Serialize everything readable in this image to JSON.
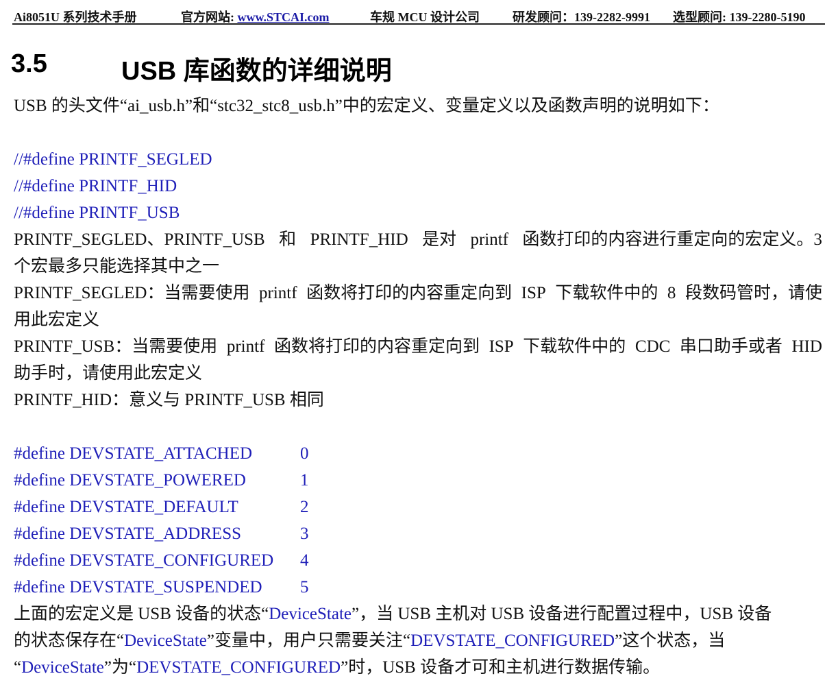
{
  "header": {
    "manual": "Ai8051U 系列技术手册",
    "site_label": "官方网站: ",
    "site_link": "www.STCAI.com",
    "company": "车规 MCU 设计公司",
    "rd_consultant": "研发顾问：139-2282-9991",
    "selection_consultant": "选型顾问: 139-2280-5190"
  },
  "section": {
    "number": "3.5",
    "title": "USB 库函数的详细说明"
  },
  "intro": "USB 的头文件“ai_usb.h”和“stc32_stc8_usb.h”中的宏定义、变量定义以及函数声明的说明如下：",
  "printf_defines": [
    "//#define PRINTF_SEGLED",
    "//#define PRINTF_HID",
    "//#define PRINTF_USB"
  ],
  "printf_desc": [
    [
      "PRINTF_SEGLED、PRINTF_USB",
      "和",
      "PRINTF_HID",
      "是对",
      "printf",
      "函数打印的内容进行重定向的宏定义。3"
    ],
    "个宏最多只能选择其中之一",
    [
      "PRINTF_SEGLED：当需要使用",
      "printf",
      "函数将打印的内容重定向到",
      "ISP",
      "下载软件中的",
      "8",
      "段数码管时，请使"
    ],
    "用此宏定义",
    [
      "PRINTF_USB：当需要使用",
      "printf",
      "函数将打印的内容重定向到",
      "ISP",
      "下载软件中的",
      "CDC",
      "串口助手或者",
      "HID"
    ],
    "助手时，请使用此宏定义",
    "PRINTF_HID：意义与 PRINTF_USB 相同"
  ],
  "devstate_defines": [
    {
      "name": "#define DEVSTATE_ATTACHED",
      "value": "0"
    },
    {
      "name": "#define DEVSTATE_POWERED",
      "value": "1"
    },
    {
      "name": "#define DEVSTATE_DEFAULT",
      "value": "2"
    },
    {
      "name": "#define DEVSTATE_ADDRESS",
      "value": "3"
    },
    {
      "name": "#define DEVSTATE_CONFIGURED",
      "value": "4"
    },
    {
      "name": "#define DEVSTATE_SUSPENDED",
      "value": "5"
    }
  ],
  "final_para": {
    "l1_a": "上面的宏定义是 USB 设备的状态“",
    "l1_b": "DeviceState",
    "l1_c": "”，当 USB 主机对 USB 设备进行配置过程中，USB 设备",
    "l2_a": "的状态保存在“",
    "l2_b": "DeviceState",
    "l2_c": "”变量中，用户只需要关注“",
    "l2_d": "DEVSTATE_CONFIGURED",
    "l2_e": "”这个状态，当",
    "l3_a": "“",
    "l3_b": "DeviceState",
    "l3_c": "”为“",
    "l3_d": "DEVSTATE_CONFIGURED",
    "l3_e": "”时，USB 设备才可和主机进行数据传输。"
  },
  "colors": {
    "code": "#1f1fb8",
    "text": "#111111"
  }
}
